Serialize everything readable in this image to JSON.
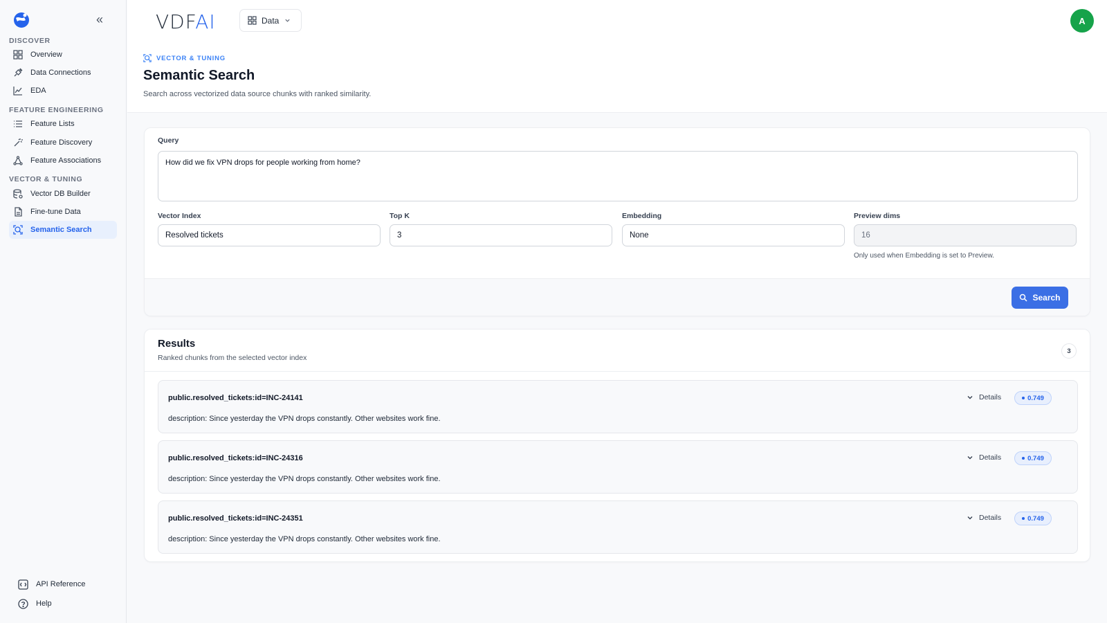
{
  "sidebar": {
    "sections": [
      {
        "label": "DISCOVER"
      },
      {
        "label": "FEATURE ENGINEERING"
      },
      {
        "label": "VECTOR & TUNING"
      }
    ],
    "items": [
      {
        "label": "Overview",
        "icon": "grid-icon"
      },
      {
        "label": "Data Connections",
        "icon": "plug-icon"
      },
      {
        "label": "EDA",
        "icon": "chart-area-icon"
      },
      {
        "label": "Feature Lists",
        "icon": "list-icon"
      },
      {
        "label": "Feature Discovery",
        "icon": "magic-wand-icon"
      },
      {
        "label": "Feature Associations",
        "icon": "network-icon"
      },
      {
        "label": "Vector DB Builder",
        "icon": "database-icon"
      },
      {
        "label": "Fine-tune Data",
        "icon": "file-icon"
      },
      {
        "label": "Semantic Search",
        "icon": "search-scan-icon",
        "active": true
      }
    ],
    "footer": [
      {
        "label": "API Reference",
        "icon": "api-icon"
      },
      {
        "label": "Help",
        "icon": "help-icon"
      }
    ]
  },
  "header": {
    "brand_main": "VDF",
    "brand_accent": "AI",
    "data_dropdown": "Data",
    "avatar_initial": "A",
    "avatar_color": "#16a34a"
  },
  "page": {
    "eyebrow": "VECTOR & TUNING",
    "title": "Semantic Search",
    "subtitle": "Search across vectorized data source chunks with ranked similarity."
  },
  "query": {
    "label": "Query",
    "value": "How did we fix VPN drops for people working from home?",
    "fields": {
      "vector_index": {
        "label": "Vector Index",
        "value": "Resolved tickets"
      },
      "top_k": {
        "label": "Top K",
        "value": "3"
      },
      "embedding": {
        "label": "Embedding",
        "value": "None"
      },
      "preview_dims": {
        "label": "Preview dims",
        "value": "16",
        "hint": "Only used when Embedding is set to Preview."
      }
    },
    "search_label": "Search"
  },
  "results": {
    "title": "Results",
    "subtitle": "Ranked chunks from the selected vector index",
    "count": "3",
    "details_label": "Details",
    "items": [
      {
        "id": "public.resolved_tickets:id=INC-24141",
        "description": "description: Since yesterday the VPN drops constantly. Other websites work fine.",
        "score": "0.749"
      },
      {
        "id": "public.resolved_tickets:id=INC-24316",
        "description": "description: Since yesterday the VPN drops constantly. Other websites work fine.",
        "score": "0.749"
      },
      {
        "id": "public.resolved_tickets:id=INC-24351",
        "description": "description: Since yesterday the VPN drops constantly. Other websites work fine.",
        "score": "0.749"
      }
    ]
  },
  "colors": {
    "accent": "#2563eb",
    "button": "#3b6fe5",
    "active_bg": "#e8f0fd"
  }
}
